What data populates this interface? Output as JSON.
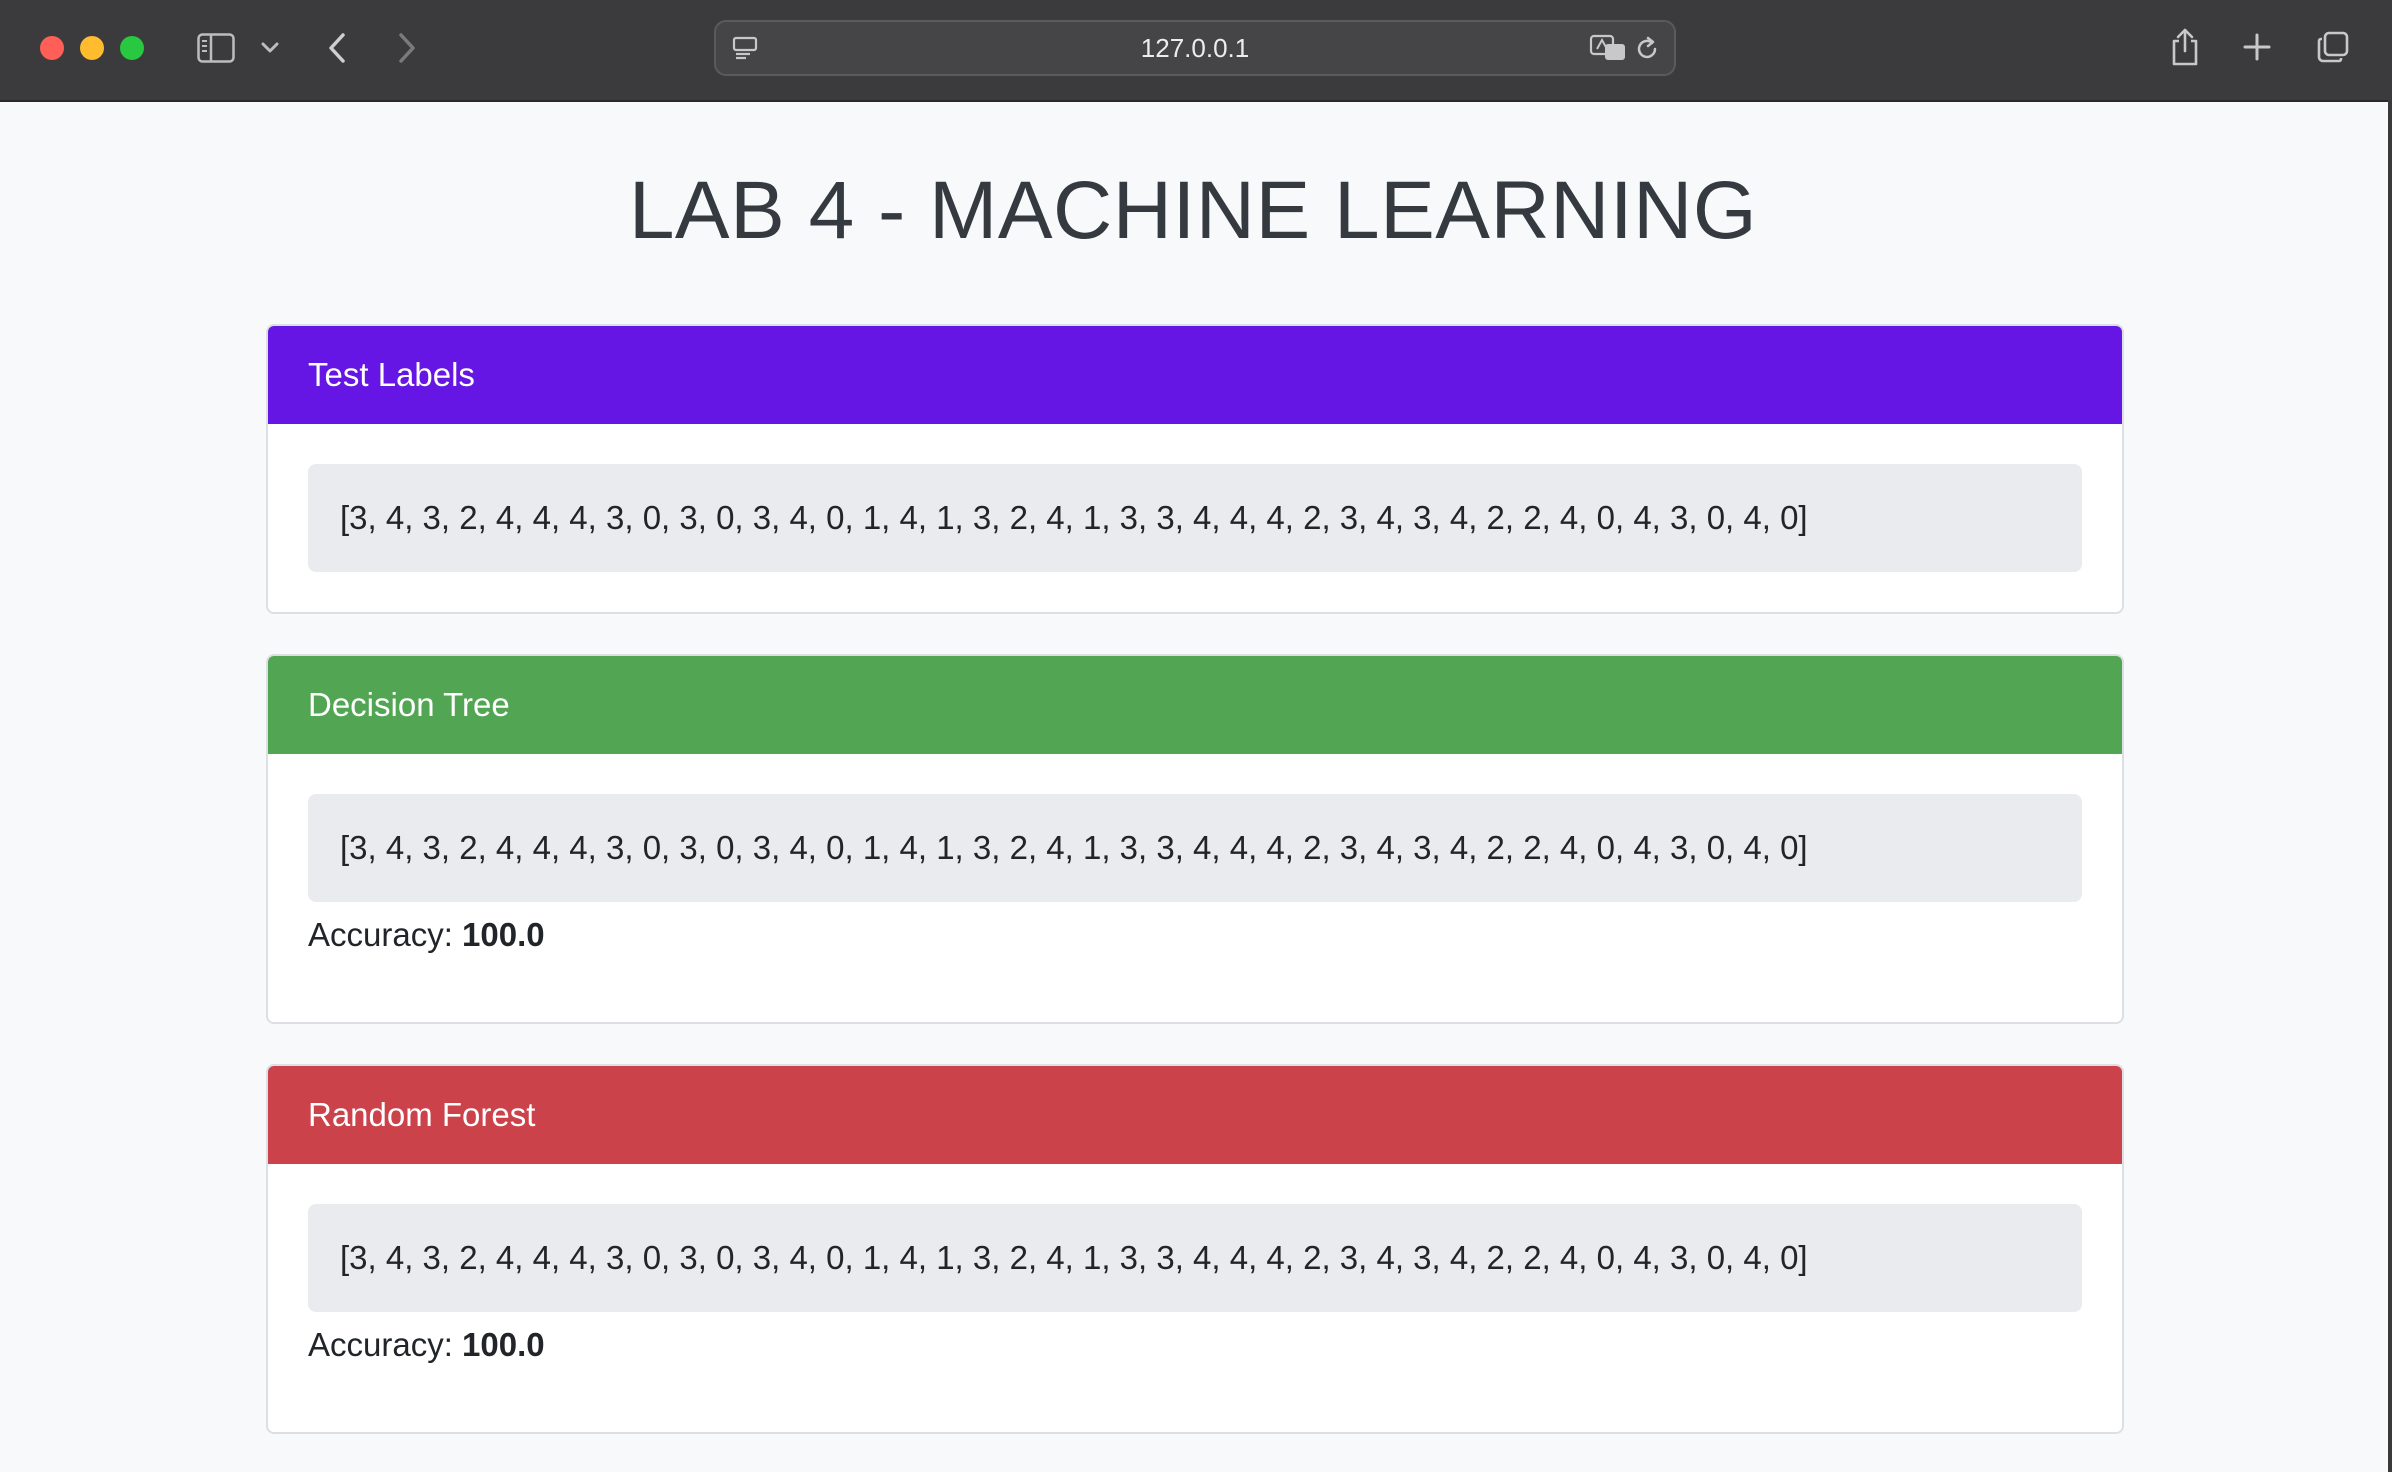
{
  "browser": {
    "url": "127.0.0.1"
  },
  "page": {
    "title": "LAB 4 - MACHINE LEARNING"
  },
  "colors": {
    "test_labels_header": "#6515e4",
    "decision_tree_header": "#52a653",
    "random_forest_header": "#cc424a"
  },
  "cards": {
    "test_labels": {
      "title": "Test Labels",
      "labels": "[3, 4, 3, 2, 4, 4, 4, 3, 0, 3, 0, 3, 4, 0, 1, 4, 1, 3, 2, 4, 1, 3, 3, 4, 4, 4, 2, 3, 4, 3, 4, 2, 2, 4, 0, 4, 3, 0, 4, 0]"
    },
    "decision_tree": {
      "title": "Decision Tree",
      "labels": "[3, 4, 3, 2, 4, 4, 4, 3, 0, 3, 0, 3, 4, 0, 1, 4, 1, 3, 2, 4, 1, 3, 3, 4, 4, 4, 2, 3, 4, 3, 4, 2, 2, 4, 0, 4, 3, 0, 4, 0]",
      "accuracy_label": "Accuracy:",
      "accuracy_value": "100.0"
    },
    "random_forest": {
      "title": "Random Forest",
      "labels": "[3, 4, 3, 2, 4, 4, 4, 3, 0, 3, 0, 3, 4, 0, 1, 4, 1, 3, 2, 4, 1, 3, 3, 4, 4, 4, 2, 3, 4, 3, 4, 2, 2, 4, 0, 4, 3, 0, 4, 0]",
      "accuracy_label": "Accuracy:",
      "accuracy_value": "100.0"
    }
  }
}
